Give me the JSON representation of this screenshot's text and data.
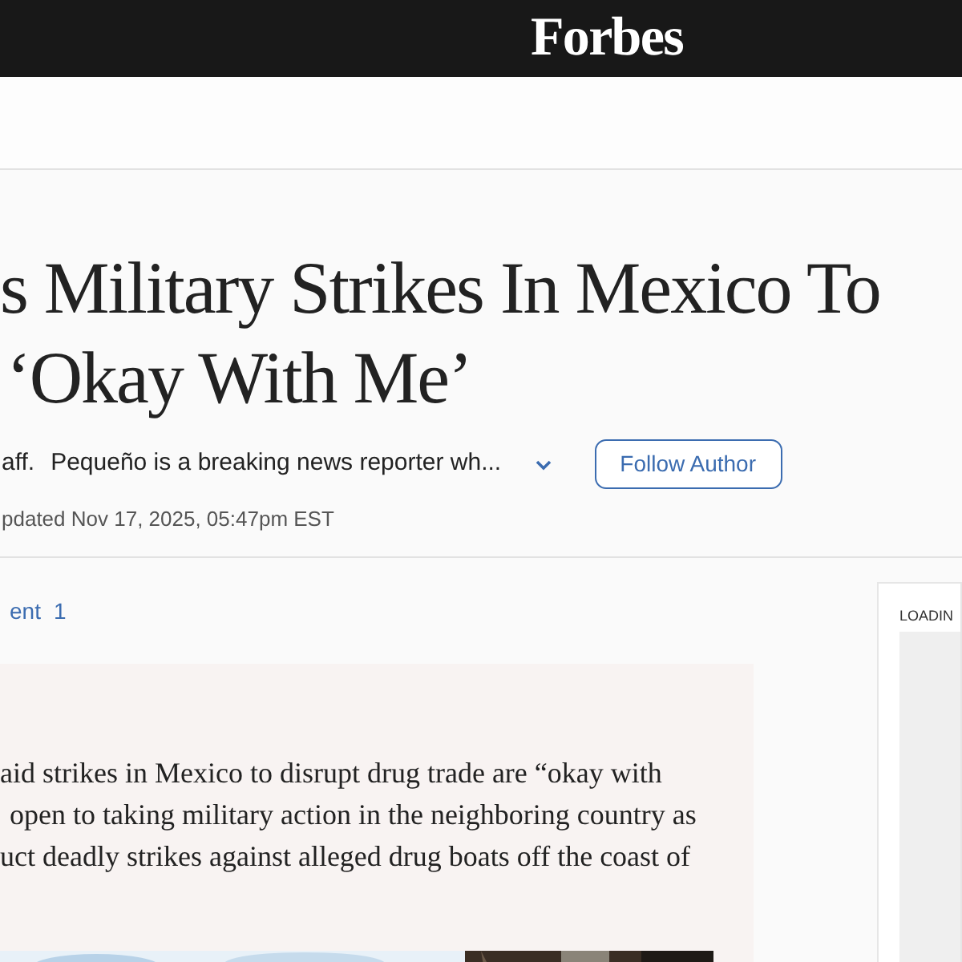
{
  "header": {
    "logo": "Forbes"
  },
  "article": {
    "headline": [
      "s Military Strikes In Mexico To",
      "‘Okay With Me’"
    ],
    "byline": {
      "author_tail": "aff.",
      "bio": "Pequeño is a breaking news reporter wh...",
      "follow_button": "Follow Author"
    },
    "updated": "pdated Nov 17, 2025, 05:47pm EST",
    "comments": {
      "label": "ent",
      "count": "1"
    },
    "summary": [
      "aid strikes in Mexico to disrupt drug trade are “okay with",
      "open to taking military action in the neighboring country as",
      "uct deadly strikes against alleged drug boats off the coast of"
    ],
    "image": {
      "kind": "picture"
    }
  },
  "sidebar": {
    "status": "LOADIN"
  }
}
